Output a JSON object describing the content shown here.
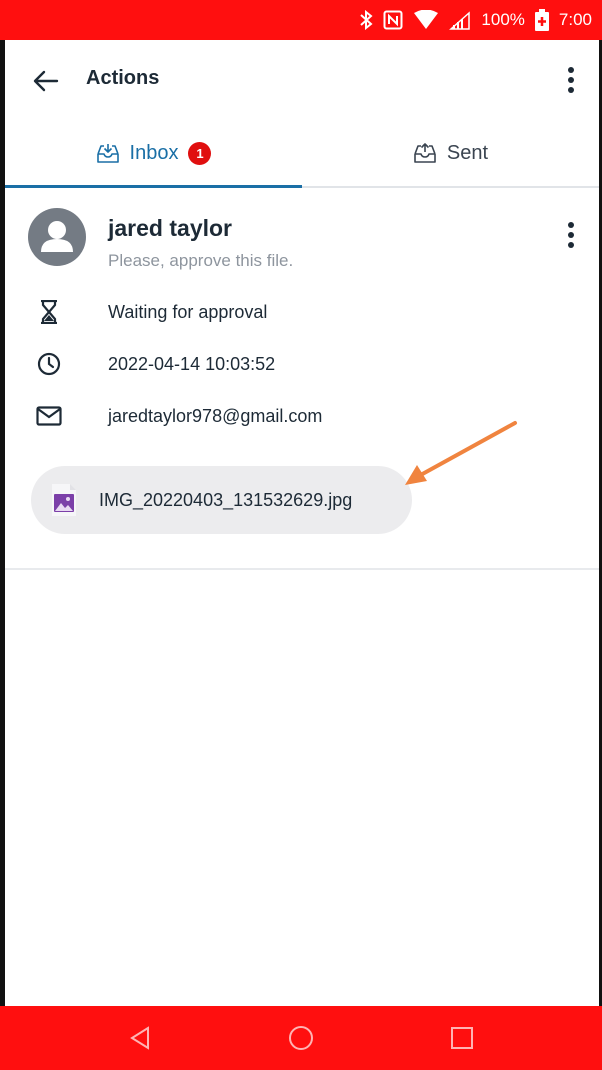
{
  "status_bar": {
    "battery": "100%",
    "time": "7:00",
    "icons": [
      "bluetooth-icon",
      "nfc-icon",
      "wifi-icon",
      "signal-icon",
      "battery-icon"
    ]
  },
  "header": {
    "title": "Actions",
    "back_icon": "arrow-left-icon",
    "menu_icon": "more-vertical-icon"
  },
  "tabs": [
    {
      "label": "Inbox",
      "icon": "inbox-icon",
      "badge": "1",
      "active": true
    },
    {
      "label": "Sent",
      "icon": "outbox-icon",
      "active": false
    }
  ],
  "action": {
    "sender_name": "jared taylor",
    "message": "Please, approve this file.",
    "status": "Waiting for approval",
    "timestamp": "2022-04-14 10:03:52",
    "email": "jaredtaylor978@gmail.com",
    "file_name": "IMG_20220403_131532629.jpg"
  },
  "colors": {
    "accent": "#1a6fa6",
    "status_bar": "#ff0f0f",
    "badge": "#e00f0f",
    "annotation_arrow": "#f0843f",
    "file_icon": "#7b3fa8"
  }
}
